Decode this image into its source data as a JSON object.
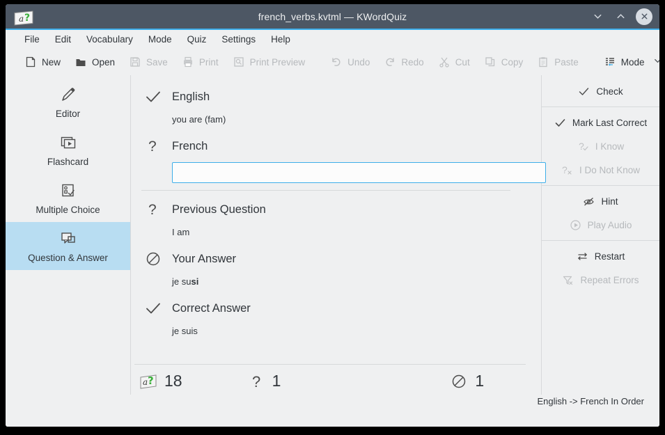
{
  "window": {
    "title": "french_verbs.kvtml — KWordQuiz",
    "app_icon": "kwordquiz-app-icon",
    "controls": [
      {
        "name": "minimize-button",
        "icon": "chevron-down-icon"
      },
      {
        "name": "maximize-button",
        "icon": "chevron-up-icon"
      },
      {
        "name": "close-button",
        "icon": "close-icon"
      }
    ]
  },
  "menubar": {
    "items": [
      {
        "label": "File"
      },
      {
        "label": "Edit"
      },
      {
        "label": "Vocabulary"
      },
      {
        "label": "Mode"
      },
      {
        "label": "Quiz"
      },
      {
        "label": "Settings"
      },
      {
        "label": "Help"
      }
    ]
  },
  "toolbar": {
    "items": [
      {
        "label": "New",
        "icon": "new-document-icon",
        "enabled": true
      },
      {
        "label": "Open",
        "icon": "folder-open-icon",
        "enabled": true
      },
      {
        "label": "Save",
        "icon": "floppy-save-icon",
        "enabled": false
      },
      {
        "label": "Print",
        "icon": "printer-icon",
        "enabled": false
      },
      {
        "label": "Print Preview",
        "icon": "print-preview-icon",
        "enabled": false
      },
      {
        "label": "Undo",
        "icon": "undo-arrow-icon",
        "enabled": false
      },
      {
        "label": "Redo",
        "icon": "redo-arrow-icon",
        "enabled": false
      },
      {
        "label": "Cut",
        "icon": "scissors-icon",
        "enabled": false
      },
      {
        "label": "Copy",
        "icon": "copy-icon",
        "enabled": false
      },
      {
        "label": "Paste",
        "icon": "clipboard-paste-icon",
        "enabled": false
      },
      {
        "label": "Mode",
        "icon": "mode-list-icon",
        "enabled": true,
        "has_menu": true
      }
    ]
  },
  "sidebar": {
    "items": [
      {
        "label": "Editor",
        "icon": "pencil-icon",
        "selected": false
      },
      {
        "label": "Flashcard",
        "icon": "flashcard-icon",
        "selected": false
      },
      {
        "label": "Multiple Choice",
        "icon": "multiple-choice-icon",
        "selected": false
      },
      {
        "label": "Question & Answer",
        "icon": "question-answer-icon",
        "selected": true
      }
    ]
  },
  "quiz": {
    "blocks": [
      {
        "title": "English",
        "icon": "check-mark-icon",
        "value": "you are (fam)",
        "type": "text"
      },
      {
        "title": "French",
        "icon": "question-mark-icon",
        "type": "input",
        "input_value": "",
        "input_placeholder": ""
      },
      {
        "title": "Previous Question",
        "icon": "question-mark-icon",
        "value": "I am",
        "type": "text"
      },
      {
        "title": "Your Answer",
        "icon": "prohibition-icon",
        "value_prefix": "je su",
        "value_bold": "si",
        "type": "rich"
      },
      {
        "title": "Correct Answer",
        "icon": "check-mark-icon",
        "value": "je suis",
        "type": "text"
      }
    ],
    "counters": [
      {
        "icon": "kwordquiz-app-icon",
        "value": "18",
        "name": "total-count"
      },
      {
        "icon": "question-mark-icon",
        "value": "1",
        "name": "asked-count"
      },
      {
        "icon": "prohibition-icon",
        "value": "1",
        "name": "error-count"
      }
    ]
  },
  "rightbar": {
    "groups": [
      {
        "items": [
          {
            "label": "Check",
            "icon": "check-mark-icon",
            "enabled": true
          }
        ]
      },
      {
        "items": [
          {
            "label": "Mark Last Correct",
            "icon": "check-mark-icon",
            "enabled": true
          },
          {
            "label": "I Know",
            "icon": "question-check-icon",
            "enabled": false
          },
          {
            "label": "I Do Not Know",
            "icon": "question-x-icon",
            "enabled": false
          }
        ]
      },
      {
        "items": [
          {
            "label": "Hint",
            "icon": "hidden-eye-icon",
            "enabled": true
          },
          {
            "label": "Play Audio",
            "icon": "play-circle-icon",
            "enabled": false
          }
        ]
      },
      {
        "items": [
          {
            "label": "Restart",
            "icon": "restart-arrows-icon",
            "enabled": true
          },
          {
            "label": "Repeat Errors",
            "icon": "filter-x-icon",
            "enabled": false
          }
        ]
      }
    ]
  },
  "statusbar": {
    "mode_text": "English -> French In Order"
  },
  "colors": {
    "titlebar": "#4d5764",
    "accent": "#3daee9",
    "background": "#eff0f1",
    "selection": "#b8ddf2",
    "text": "#31363b",
    "disabled_text": "#b6b9bc"
  }
}
